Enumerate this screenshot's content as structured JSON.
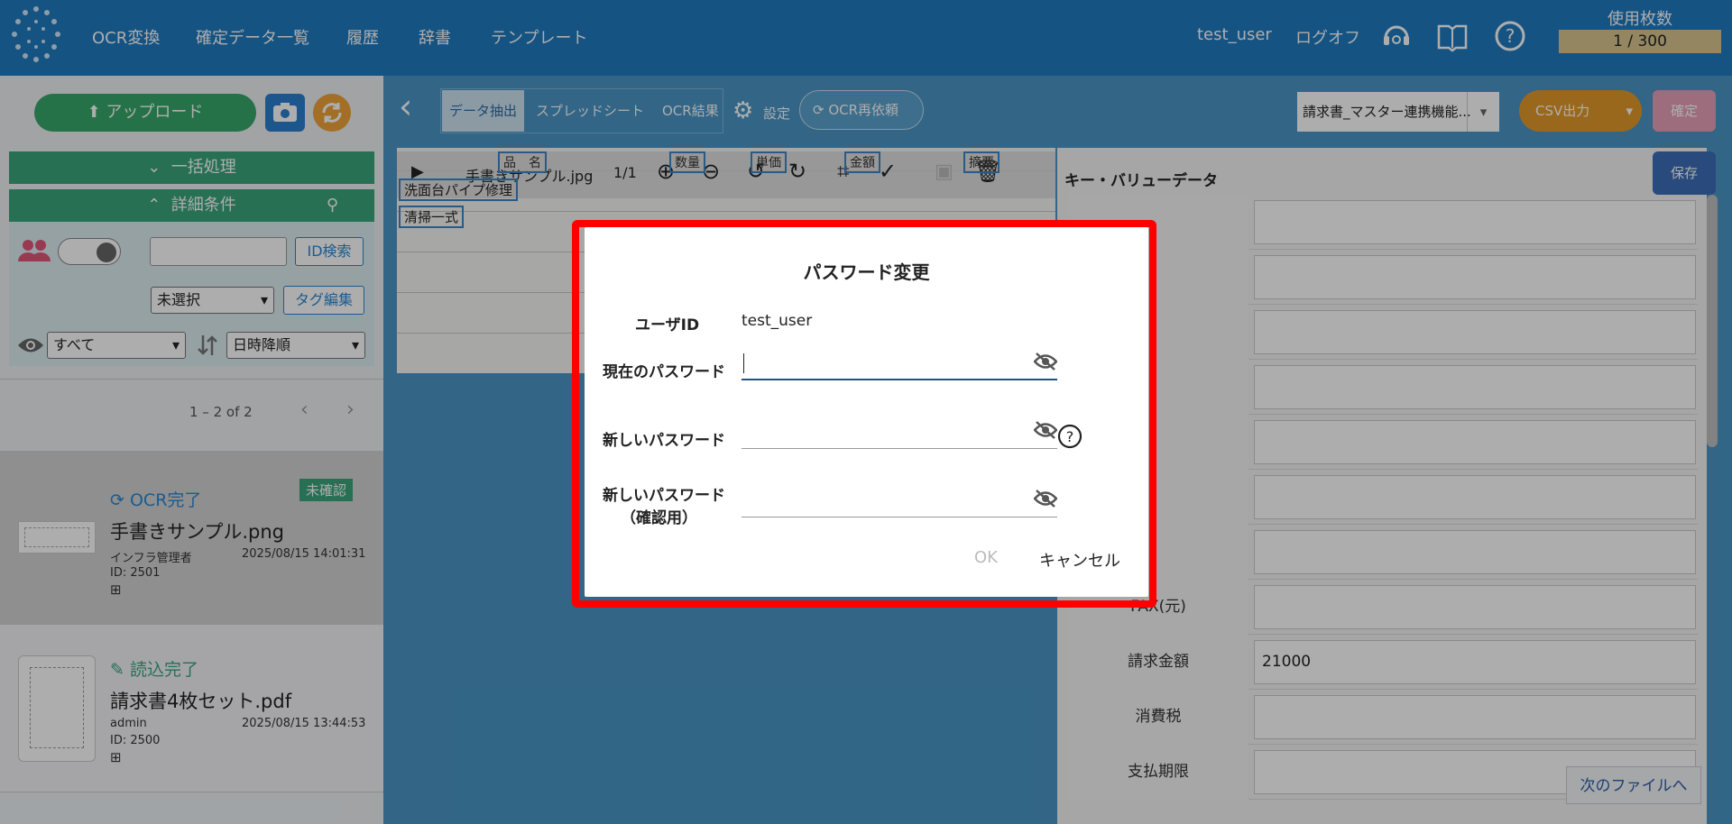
{
  "header": {
    "nav": [
      "OCR変換",
      "確定データ一覧",
      "履歴",
      "辞書",
      "テンプレート"
    ],
    "user": "test_user",
    "logoff": "ログオフ",
    "usage_label": "使用枚数",
    "usage_value": "1 / 300"
  },
  "sidebar": {
    "upload": "アップロード",
    "batch": "一括処理",
    "detail": "詳細条件",
    "id_search": "ID検索",
    "tag_select": "未選択",
    "tag_edit": "タグ編集",
    "view_select": "すべて",
    "sort_select": "日時降順",
    "pager": "1 – 2 of 2"
  },
  "files": [
    {
      "status": "OCR完了",
      "badge": "未確認",
      "name": "手書きサンプル.png",
      "user": "インフラ管理者",
      "date": "2025/08/15 14:01:31",
      "id": "ID: 2501"
    },
    {
      "status": "読込完了",
      "name": "請求書4枚セット.pdf",
      "user": "admin",
      "date": "2025/08/15 13:44:53",
      "id": "ID: 2500"
    }
  ],
  "toolbar": {
    "tabs": [
      "データ抽出",
      "スプレッドシート",
      "OCR結果"
    ],
    "settings": "設定",
    "reocr": "OCR再依頼",
    "template_select": "請求書_マスター連携機能...",
    "csv": "CSV出力",
    "confirm": "確定",
    "save": "保存"
  },
  "doc": {
    "filename": "手書きサンプル.jpg",
    "page": "1/1",
    "table_headers": [
      "品　名",
      "数量",
      "単価",
      "金額",
      "摘要"
    ],
    "rows": [
      "洗面台パイプ修理",
      "清掃一式"
    ]
  },
  "kv": {
    "title": "キー・バリューデータ",
    "rows": [
      {
        "label": "",
        "value": ""
      },
      {
        "label": "",
        "value": ""
      },
      {
        "label": "",
        "value": ""
      },
      {
        "label": "",
        "value": ""
      },
      {
        "label": "",
        "value": ""
      },
      {
        "label": "",
        "value": ""
      },
      {
        "label": "",
        "value": ""
      },
      {
        "label": "FAX(元)",
        "value": ""
      },
      {
        "label": "請求金額",
        "value": "21000"
      },
      {
        "label": "消費税",
        "value": ""
      },
      {
        "label": "支払期限",
        "value": ""
      }
    ],
    "next_file": "次のファイルへ"
  },
  "dialog": {
    "title": "パスワード変更",
    "userid_label": "ユーザID",
    "userid_value": "test_user",
    "current_label": "現在のパスワード",
    "new_label": "新しいパスワード",
    "confirm_label1": "新しいパスワード",
    "confirm_label2": "（確認用）",
    "ok": "OK",
    "cancel": "キャンセル"
  }
}
